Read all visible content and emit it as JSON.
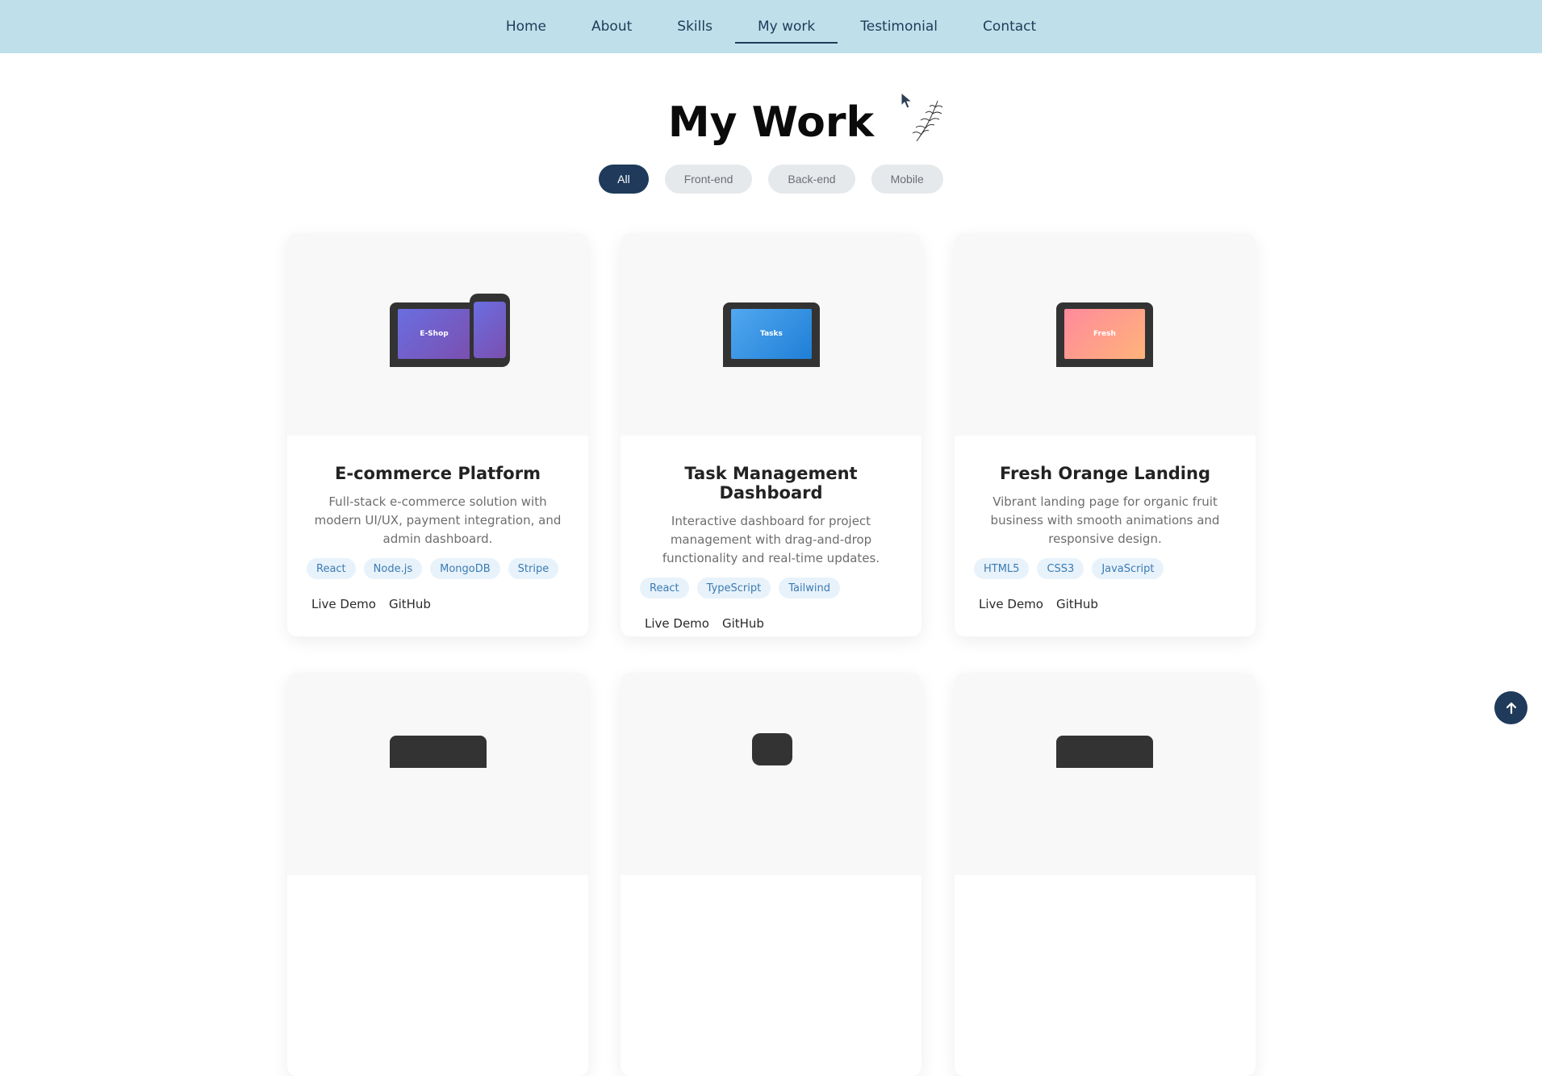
{
  "nav": {
    "items": [
      {
        "label": "Home"
      },
      {
        "label": "About"
      },
      {
        "label": "Skills"
      },
      {
        "label": "My work"
      },
      {
        "label": "Testimonial"
      },
      {
        "label": "Contact"
      }
    ],
    "active": "My work"
  },
  "section": {
    "title": "My Work"
  },
  "filters": [
    {
      "label": "All"
    },
    {
      "label": "Front-end"
    },
    {
      "label": "Back-end"
    },
    {
      "label": "Mobile"
    }
  ],
  "projects": [
    {
      "title": "E-commerce Platform",
      "description": "Full-stack e-commerce solution with modern UI/UX, payment integration, and admin dashboard.",
      "tags": [
        "React",
        "Node.js",
        "MongoDB",
        "Stripe"
      ],
      "screen_label": "E-Shop",
      "links": [
        "Live Demo",
        "GitHub"
      ]
    },
    {
      "title": "Task Management Dashboard",
      "description": "Interactive dashboard for project management with drag-and-drop functionality and real-time updates.",
      "tags": [
        "React",
        "TypeScript",
        "Tailwind"
      ],
      "screen_label": "Tasks",
      "links": [
        "Live Demo",
        "GitHub"
      ]
    },
    {
      "title": "Fresh Orange Landing",
      "description": "Vibrant landing page for organic fruit business with smooth animations and responsive design.",
      "tags": [
        "HTML5",
        "CSS3",
        "JavaScript"
      ],
      "screen_label": "Fresh",
      "links": [
        "Live Demo",
        "GitHub"
      ]
    }
  ],
  "colors": {
    "nav_bg": "#bfe0ea",
    "accent": "#1f3a5a",
    "tag_bg": "#e8f2fa",
    "tag_text": "#3b7bb3"
  },
  "icons": {
    "back_to_top": "arrow-up-icon",
    "decor": "plant-sprig-icon"
  }
}
